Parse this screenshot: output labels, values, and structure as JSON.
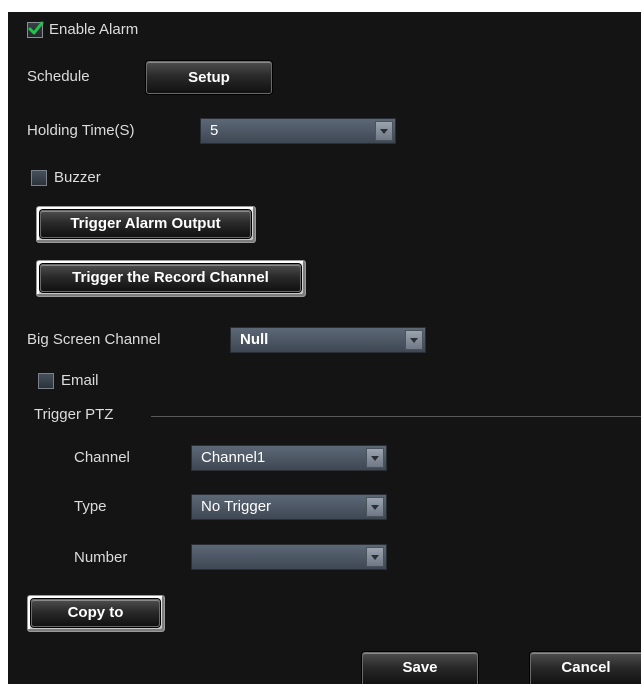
{
  "alarm": {
    "enable_label": "Enable Alarm",
    "enabled": true
  },
  "schedule": {
    "label": "Schedule",
    "setup_button": "Setup"
  },
  "holding_time": {
    "label": "Holding Time(S)",
    "value": "5"
  },
  "buzzer": {
    "label": "Buzzer",
    "checked": false
  },
  "trigger_alarm_output_button": "Trigger Alarm Output",
  "trigger_record_channel_button": "Trigger the Record Channel",
  "big_screen": {
    "label": "Big Screen Channel",
    "value": "Null"
  },
  "email": {
    "label": "Email",
    "checked": false
  },
  "trigger_ptz": {
    "title": "Trigger PTZ",
    "channel": {
      "label": "Channel",
      "value": "Channel1"
    },
    "type": {
      "label": "Type",
      "value": "No Trigger"
    },
    "number": {
      "label": "Number",
      "value": ""
    }
  },
  "copy_to_button": "Copy to",
  "footer": {
    "save_button": "Save",
    "cancel_button": "Cancel"
  },
  "colors": {
    "panel_bg": "#141414",
    "check_green": "#22c34a",
    "select_bg": "#4f5967"
  }
}
